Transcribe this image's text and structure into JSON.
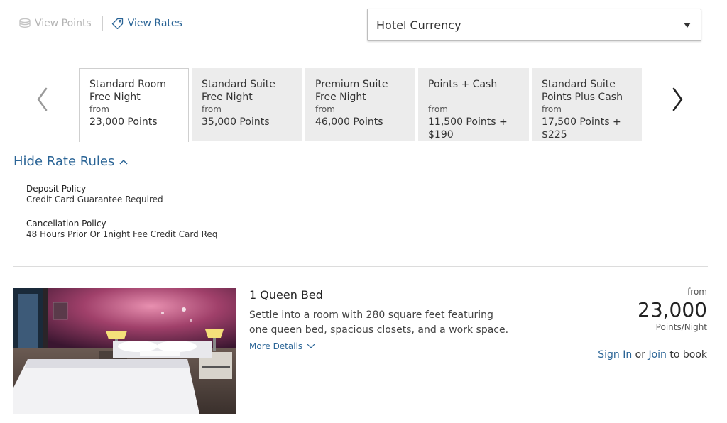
{
  "view_toggle": {
    "points_label": "View Points",
    "rates_label": "View Rates"
  },
  "currency": {
    "selected": "Hotel Currency"
  },
  "rate_tabs": [
    {
      "name_line1": "Standard Room",
      "name_line2": "Free Night",
      "from": "from",
      "points_line1": "23,000 Points",
      "points_line2": ""
    },
    {
      "name_line1": "Standard Suite",
      "name_line2": "Free Night",
      "from": "from",
      "points_line1": "35,000 Points",
      "points_line2": ""
    },
    {
      "name_line1": "Premium Suite",
      "name_line2": "Free Night",
      "from": "from",
      "points_line1": "46,000 Points",
      "points_line2": ""
    },
    {
      "name_line1": "Points + Cash",
      "name_line2": "",
      "from": "from",
      "points_line1": "11,500 Points +",
      "points_line2": "$190"
    },
    {
      "name_line1": "Standard Suite",
      "name_line2": "Points Plus Cash",
      "from": "from",
      "points_line1": "17,500 Points +",
      "points_line2": "$225"
    }
  ],
  "rate_rules": {
    "toggle_label": "Hide Rate Rules",
    "deposit_label": "Deposit Policy",
    "deposit_value": "Credit Card Guarantee Required",
    "cancellation_label": "Cancellation Policy",
    "cancellation_value": "48 Hours Prior Or 1night Fee Credit Card Req"
  },
  "room": {
    "title": "1 Queen Bed",
    "description": "Settle into a room with 280 square feet featuring one queen bed, spacious closets, and a work space.",
    "more_details": "More Details",
    "price_from": "from",
    "price_amount": "23,000",
    "price_unit": "Points/Night",
    "sign_in": "Sign In",
    "or": "or",
    "join": "Join",
    "to_book": "to book"
  },
  "colors": {
    "link": "#2a6496",
    "tab_bg": "#ececec",
    "border": "#cfcfcf"
  }
}
